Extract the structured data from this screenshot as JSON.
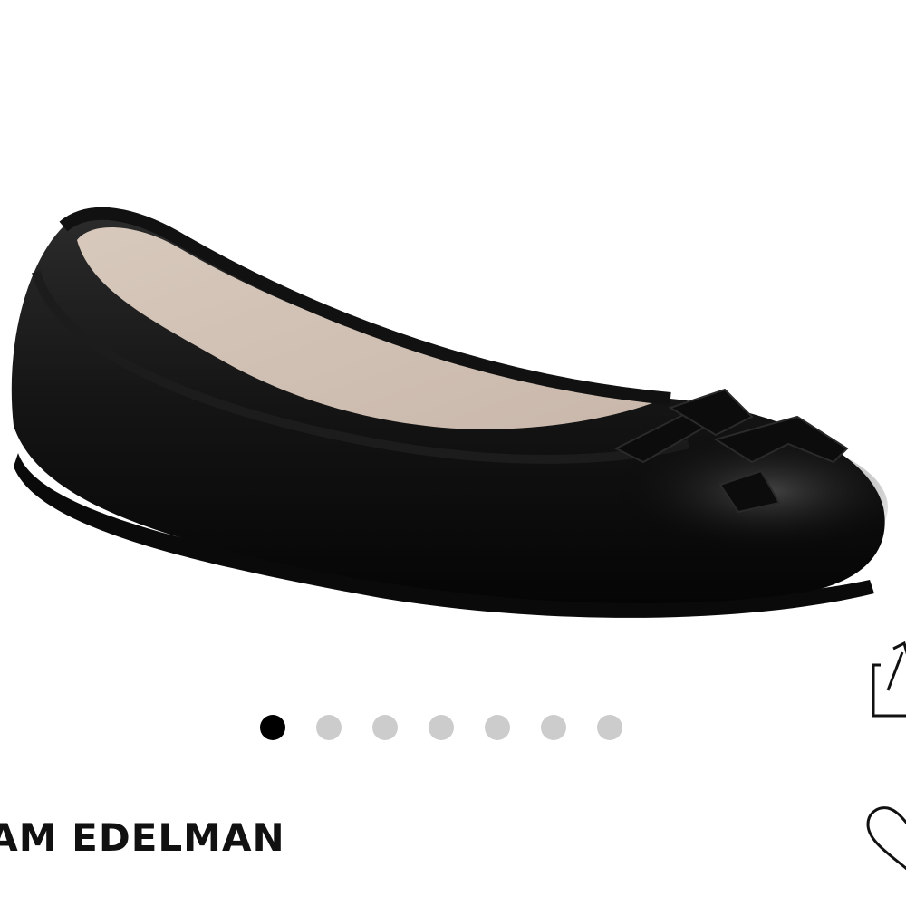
{
  "product": {
    "brand": "SAM EDELMAN",
    "image_icon": "black-leather-ballet-flat"
  },
  "carousel": {
    "total": 7,
    "active_index": 0,
    "active_color": "#000000",
    "inactive_color": "#cccccc"
  },
  "actions": {
    "share_icon": "share-icon",
    "wishlist_icon": "heart-outline-icon"
  }
}
